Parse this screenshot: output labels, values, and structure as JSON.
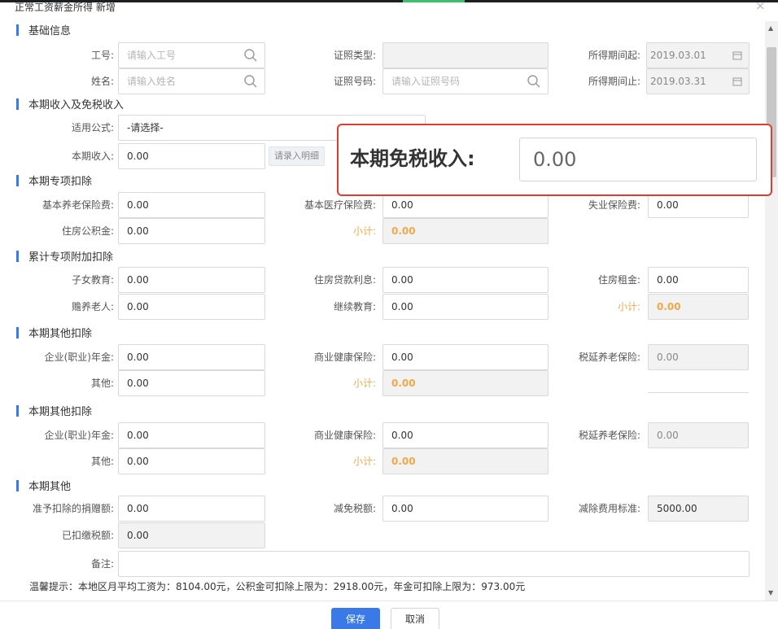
{
  "dialog": {
    "title": "正常工资薪金所得 新增",
    "close": "×"
  },
  "colors": {
    "primary": "#3a79e8",
    "subtotal": "#f0a848",
    "callout_border": "#e23b2f"
  },
  "basic": {
    "title": "基础信息",
    "emp_id_label": "工号:",
    "emp_id_placeholder": "请输入工号",
    "name_label": "姓名:",
    "name_placeholder": "请输入姓名",
    "id_type_label": "证照类型:",
    "id_type_value": "",
    "id_no_label": "证照号码:",
    "id_no_placeholder": "请输入证照号码",
    "period_start_label": "所得期间起:",
    "period_start_value": "2019.03.01",
    "period_end_label": "所得期间止:",
    "period_end_value": "2019.03.31"
  },
  "income": {
    "title": "本期收入及免税收入",
    "formula_label": "适用公式:",
    "formula_value": "-请选择-",
    "income_label": "本期收入:",
    "income_value": "0.00",
    "detail_button": "请录入明细"
  },
  "callout": {
    "label": "本期免税收入:",
    "value": "0.00"
  },
  "special": {
    "title": "本期专项扣除",
    "pension_label": "基本养老保险费:",
    "pension_value": "0.00",
    "medical_label": "基本医疗保险费:",
    "medical_value": "0.00",
    "unemployment_label": "失业保险费:",
    "unemployment_value": "0.00",
    "housing_fund_label": "住房公积金:",
    "housing_fund_value": "0.00",
    "subtotal_label": "小计:",
    "subtotal_value": "0.00"
  },
  "additional": {
    "title": "累计专项附加扣除",
    "children_label": "子女教育:",
    "children_value": "0.00",
    "loan_label": "住房贷款利息:",
    "loan_value": "0.00",
    "rent_label": "住房租金:",
    "rent_value": "0.00",
    "elderly_label": "赡养老人:",
    "elderly_value": "0.00",
    "continuing_label": "继续教育:",
    "continuing_value": "0.00",
    "subtotal_label": "小计:",
    "subtotal_value": "0.00"
  },
  "other1": {
    "title": "本期其他扣除",
    "annuity_label": "企业(职业)年金:",
    "annuity_value": "0.00",
    "health_label": "商业健康保险:",
    "health_value": "0.00",
    "deferred_label": "税延养老保险:",
    "deferred_value": "0.00",
    "other_label": "其他:",
    "other_value": "0.00",
    "subtotal_label": "小计:",
    "subtotal_value": "0.00"
  },
  "other2": {
    "title": "本期其他扣除",
    "annuity_label": "企业(职业)年金:",
    "annuity_value": "0.00",
    "health_label": "商业健康保险:",
    "health_value": "0.00",
    "deferred_label": "税延养老保险:",
    "deferred_value": "0.00",
    "other_label": "其他:",
    "other_value": "0.00",
    "subtotal_label": "小计:",
    "subtotal_value": "0.00"
  },
  "misc": {
    "title": "本期其他",
    "donation_label": "准予扣除的捐赠额:",
    "donation_value": "0.00",
    "relief_label": "减免税额:",
    "relief_value": "0.00",
    "standard_label": "减除费用标准:",
    "standard_value": "5000.00",
    "paid_label": "已扣缴税额:",
    "paid_value": "0.00",
    "remark_label": "备注:",
    "remark_value": ""
  },
  "tip": "温馨提示：本地区月平均工资为：8104.00元，公积金可扣除上限为：2918.00元，年金可扣除上限为：973.00元",
  "footer": {
    "save": "保存",
    "cancel": "取消"
  }
}
